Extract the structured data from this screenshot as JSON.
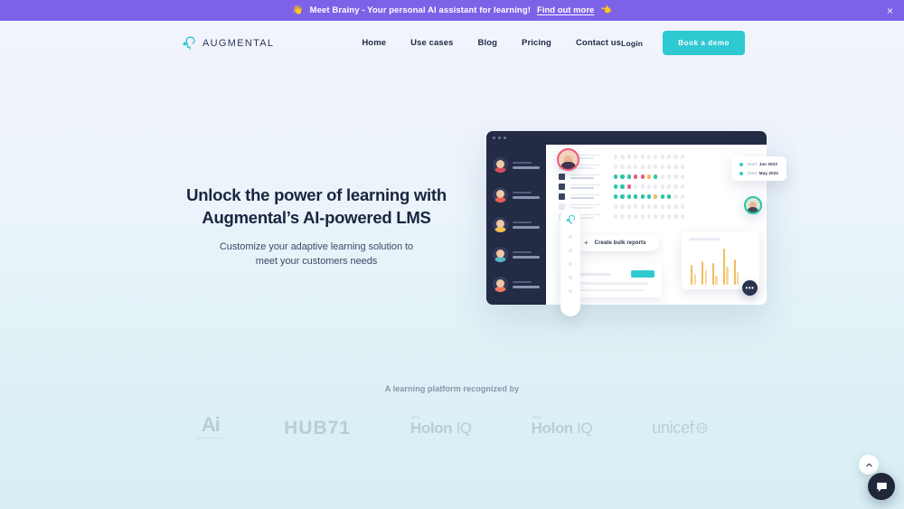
{
  "banner": {
    "emoji_left": "👋",
    "text": "Meet Brainy - Your personal AI assistant for learning!",
    "link_label": "Find out more",
    "emoji_right": "👈",
    "close_label": "×",
    "background": "#7d62e8"
  },
  "nav": {
    "brand": "AUGMENTAL",
    "brand_icon": "brain-head-icon",
    "links": [
      {
        "label": "Home"
      },
      {
        "label": "Use cases"
      },
      {
        "label": "Blog"
      },
      {
        "label": "Pricing"
      },
      {
        "label": "Contact us"
      }
    ],
    "login_label": "Login",
    "demo_label": "Book a demo",
    "demo_color": "#2fc9d2"
  },
  "hero": {
    "title_line1": "Unlock the power of learning with",
    "title_line2": "Augmental’s AI-powered LMS",
    "subtitle_line1": "Customize your adaptive learning solution to",
    "subtitle_line2": "meet your customers needs"
  },
  "dashboard": {
    "bulk_reports_label": "Create bulk reports",
    "bulk_plus": "+",
    "legend": [
      {
        "prefix": "Start:",
        "value": "Jan 2022"
      },
      {
        "prefix": "Start:",
        "value": "May 2022"
      }
    ],
    "fab_label": "•••",
    "accent_teal": "#2fc9d2",
    "dot_green": "#2ec5a5",
    "dot_pink": "#ee5b7b",
    "dot_orange": "#f4b860",
    "bar_color": "#f0bd5e",
    "matrix": [
      {
        "icon": "ghost",
        "dots": [
          "",
          "",
          "",
          "",
          "",
          "",
          "",
          "",
          "",
          "",
          ""
        ]
      },
      {
        "icon": "ghost",
        "dots": [
          "",
          "",
          "",
          "",
          "",
          "",
          "",
          "",
          "",
          "",
          ""
        ]
      },
      {
        "icon": "users-icon",
        "dots": [
          "g",
          "g",
          "g",
          "p",
          "p",
          "o",
          "g",
          "",
          "",
          "",
          ""
        ]
      },
      {
        "icon": "id-card-icon",
        "dots": [
          "g",
          "g",
          "p",
          "",
          "",
          "",
          "",
          "",
          "",
          "",
          ""
        ]
      },
      {
        "icon": "person-icon",
        "dots": [
          "g",
          "g",
          "g",
          "g",
          "g",
          "g",
          "o",
          "g",
          "g",
          "",
          ""
        ]
      },
      {
        "icon": "ghost",
        "dots": [
          "",
          "",
          "",
          "",
          "",
          "",
          "",
          "",
          "",
          "",
          ""
        ]
      },
      {
        "icon": "ghost",
        "dots": [
          "",
          "",
          "",
          "",
          "",
          "",
          "",
          "",
          "",
          "",
          ""
        ]
      }
    ],
    "bars": [
      {
        "tall": 22,
        "short": 12
      },
      {
        "tall": 26,
        "short": 16
      },
      {
        "tall": 24,
        "short": 10
      },
      {
        "tall": 40,
        "short": 20
      },
      {
        "tall": 28,
        "short": 14
      }
    ],
    "sidebar_people": 5
  },
  "recognition": {
    "title": "A learning platform recognized by",
    "logos": [
      {
        "name": "Ai",
        "sub": "EVERYTHING",
        "type": "ai"
      },
      {
        "name": "HUB71",
        "type": "hub"
      },
      {
        "name": "Holon",
        "name2": "IQ",
        "year": "2021",
        "type": "holon"
      },
      {
        "name": "Holon",
        "name2": "IQ",
        "year": "2022",
        "type": "holon"
      },
      {
        "name": "unicef",
        "type": "unicef"
      }
    ]
  },
  "widgets": {
    "scroll_top_icon": "chevron-up-icon",
    "chat_icon": "chat-bubble-icon"
  }
}
